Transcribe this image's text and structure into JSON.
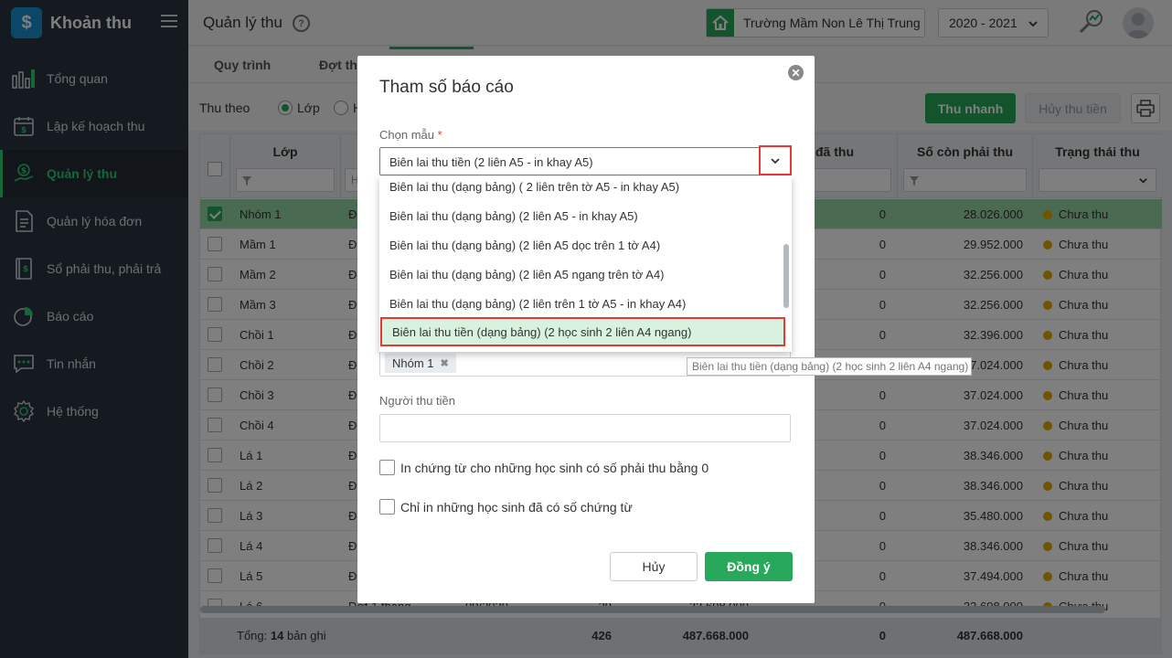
{
  "app": {
    "title": "Khoản thu",
    "logo_glyph": "$"
  },
  "sidebar": {
    "items": [
      {
        "label": "Tổng quan",
        "icon": "bar-chart-icon"
      },
      {
        "label": "Lập kế hoạch thu",
        "icon": "calendar-money-icon"
      },
      {
        "label": "Quản lý thu",
        "icon": "money-hand-icon",
        "active": true
      },
      {
        "label": "Quản lý hóa đơn",
        "icon": "invoice-icon"
      },
      {
        "label": "Sổ phải thu, phải trả",
        "icon": "book-icon"
      },
      {
        "label": "Báo cáo",
        "icon": "pie-chart-icon"
      },
      {
        "label": "Tin nhắn",
        "icon": "chat-icon"
      },
      {
        "label": "Hệ thống",
        "icon": "gear-icon"
      }
    ]
  },
  "header": {
    "title": "Quản lý thu",
    "school": "Trường Mầm Non Lê Thị Trung",
    "year": "2020 - 2021"
  },
  "tabs": [
    "Quy trình",
    "Đợt thu"
  ],
  "filter": {
    "label": "Thu theo",
    "option1": "Lớp",
    "option2": "H"
  },
  "toolbar": {
    "quick_collect": "Thu nhanh",
    "cancel_collect": "Hủy thu tiền"
  },
  "table": {
    "headers": [
      "Lớp",
      "H",
      "đã thu",
      "Số còn phải thu",
      "Trạng thái thu"
    ],
    "rows": [
      {
        "class": "Nhóm 1",
        "c2": "Đ",
        "paid": "0",
        "remaining": "28.026.000",
        "status": "Chưa thu",
        "checked": true
      },
      {
        "class": "Mầm 1",
        "c2": "Đ",
        "paid": "0",
        "remaining": "29.952.000",
        "status": "Chưa thu"
      },
      {
        "class": "Mầm 2",
        "c2": "Đ",
        "paid": "0",
        "remaining": "32.256.000",
        "status": "Chưa thu"
      },
      {
        "class": "Mầm 3",
        "c2": "Đ",
        "paid": "0",
        "remaining": "32.256.000",
        "status": "Chưa thu"
      },
      {
        "class": "Chồi 1",
        "c2": "Đ",
        "paid": "0",
        "remaining": "32.396.000",
        "status": "Chưa thu"
      },
      {
        "class": "Chồi 2",
        "c2": "Đ",
        "paid": "0",
        "remaining": "37.024.000",
        "status": "Chưa thu"
      },
      {
        "class": "Chồi 3",
        "c2": "Đ",
        "paid": "0",
        "remaining": "37.024.000",
        "status": "Chưa thu"
      },
      {
        "class": "Chồi 4",
        "c2": "Đ",
        "paid": "0",
        "remaining": "37.024.000",
        "status": "Chưa thu"
      },
      {
        "class": "Lá 1",
        "c2": "Đ",
        "paid": "0",
        "remaining": "38.346.000",
        "status": "Chưa thu"
      },
      {
        "class": "Lá 2",
        "c2": "Đ",
        "paid": "0",
        "remaining": "38.346.000",
        "status": "Chưa thu"
      },
      {
        "class": "Lá 3",
        "c2": "Đ",
        "paid": "0",
        "remaining": "35.480.000",
        "status": "Chưa thu"
      },
      {
        "class": "Lá 4",
        "c2": "Đ",
        "paid": "0",
        "remaining": "38.346.000",
        "status": "Chưa thu"
      },
      {
        "class": "Lá 5",
        "c2": "Đ",
        "paid": "0",
        "remaining": "37.494.000",
        "status": "Chưa thu"
      },
      {
        "class": "Lá 6",
        "c2": "Đợt 1 tháng ...",
        "c3": "09/2020",
        "c4": "29",
        "c5": "33.698.000",
        "paid": "0",
        "remaining": "33.698.000",
        "status": "Chưa thu"
      }
    ],
    "footer": {
      "label": "Tổng:",
      "count": "14",
      "suffix": "bản ghi",
      "sum1": "426",
      "sum2": "487.668.000",
      "paid": "0",
      "remaining": "487.668.000"
    }
  },
  "modal": {
    "title": "Tham số báo cáo",
    "template_label": "Chọn mẫu",
    "required_mark": "*",
    "selected": "Biên lai thu tiền (2 liên A5 - in khay A5)",
    "options": [
      "Biên lai thu (dạng bảng) ( 2 liên trên tờ A5 - in khay A5)",
      "Biên lai thu (dạng bảng) (2 liên A5 - in khay A5)",
      "Biên lai thu (dạng bảng) (2 liên A5 dọc trên 1 tờ A4)",
      "Biên lai thu (dạng bảng) (2 liên A5 ngang trên tờ A4)",
      "Biên lai thu (dạng bảng) (2 liên trên 1 tờ A5 - in khay A4)",
      "Biên lai thu tiền (dạng bảng) (2 học sinh 2 liên A4 ngang)"
    ],
    "class_tag": "Nhóm 1",
    "collector_label": "Người thu tiền",
    "collector_value": "",
    "check1": "In chứng từ cho những học sinh có số phải thu bằng 0",
    "check2": "Chỉ in những học sinh đã có số chứng từ",
    "cancel": "Hủy",
    "ok": "Đồng ý",
    "tooltip": "Biên lai thu tiền (dạng bảng) (2 học sinh 2 liên A4 ngang)"
  },
  "colors": {
    "brand": "#27a85b",
    "sidebar": "#2b3541",
    "highlight_border": "#e53935",
    "status_dot": "#e0a800"
  }
}
